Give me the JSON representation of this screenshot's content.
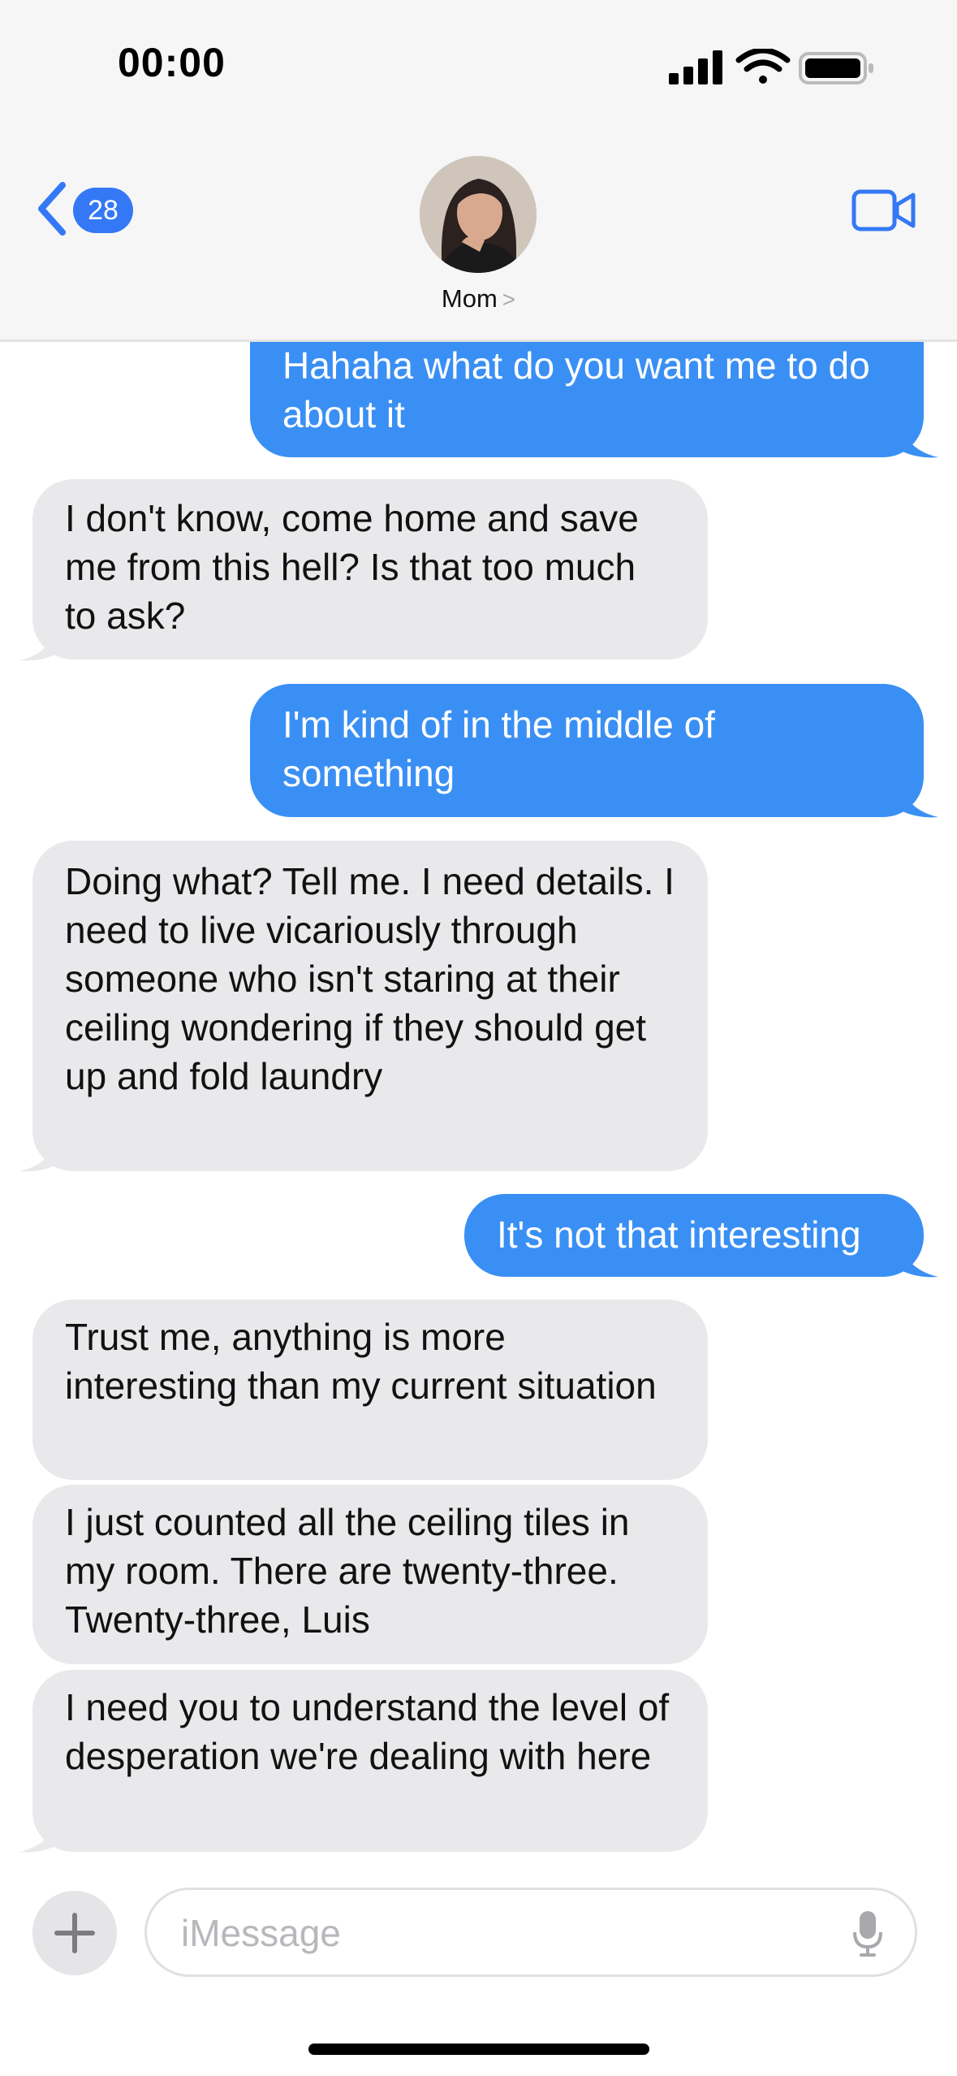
{
  "status_bar": {
    "time": "00:00"
  },
  "header": {
    "back_badge": "28",
    "contact_name": "Mom",
    "chevron": ">"
  },
  "messages": [
    {
      "from": "me",
      "text": "Hahaha what do you want me to do about it"
    },
    {
      "from": "them",
      "text": "I don't know, come home and save me from this hell? Is that too much to ask?"
    },
    {
      "from": "me",
      "text": "I'm kind of in the middle of something"
    },
    {
      "from": "them",
      "text": "Doing what? Tell me. I need details. I need to live vicariously through someone who isn't staring at their ceiling wondering if they should get up and fold laundry"
    },
    {
      "from": "me",
      "text": "It's not that interesting"
    },
    {
      "from": "them",
      "text": "Trust me, anything is more interesting than my current situation"
    },
    {
      "from": "them",
      "text": "I just counted all the ceiling tiles in my room. There are twenty-three. Twenty-three, Luis"
    },
    {
      "from": "them",
      "text": "I need you to understand the level of desperation we're dealing with here"
    }
  ],
  "compose": {
    "placeholder": "iMessage"
  },
  "colors": {
    "sent": "#3a8ff4",
    "received": "#e9e9eb",
    "accent": "#3478f6"
  }
}
